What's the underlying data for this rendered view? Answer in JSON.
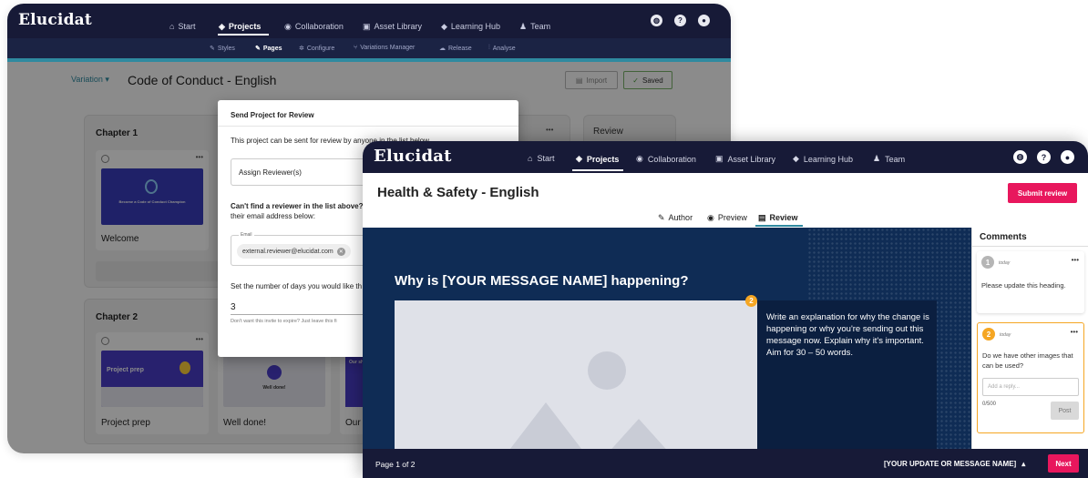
{
  "back": {
    "logo": "Elucidat",
    "nav": [
      {
        "icon": "⌂",
        "label": "Start"
      },
      {
        "icon": "◈",
        "label": "Projects"
      },
      {
        "icon": "◉",
        "label": "Collaboration"
      },
      {
        "icon": "▣",
        "label": "Asset Library"
      },
      {
        "icon": "◆",
        "label": "Learning Hub"
      },
      {
        "icon": "♟",
        "label": "Team"
      }
    ],
    "subnav": [
      {
        "icon": "✎",
        "label": "Styles"
      },
      {
        "icon": "✎",
        "label": "Pages"
      },
      {
        "icon": "✲",
        "label": "Configure"
      },
      {
        "icon": "⑂",
        "label": "Variations Manager"
      },
      {
        "icon": "☁",
        "label": "Release"
      },
      {
        "icon": "⫶",
        "label": "Analyse"
      }
    ],
    "variation_label": "Variation",
    "project_title": "Code of Conduct - English",
    "import_label": "Import",
    "saved_label": "Saved",
    "chapter1": "Chapter 1",
    "chapter2": "Chapter 2",
    "review_label": "Review",
    "page_welcome": "Welcome",
    "page_project_prep": "Project prep",
    "page_well_done": "Well done!",
    "page_our": "Our sh",
    "thumb1_text": "Become a Code of Conduct Champion",
    "thumb2_title": "Project prep",
    "thumb3_text": "Well done!",
    "thumb4_text": "Our sh",
    "more": "•••",
    "modal": {
      "title": "Send Project for Review",
      "intro": "This project can be sent for review by anyone in the list below.",
      "assign": "Assign Reviewer(s)",
      "cant_find": "Can't find a reviewer in the list above? A",
      "cant_find_2": "their email address below:",
      "email_label": "Email",
      "email_chip": "external.reviewer@elucidat.com",
      "days_label": "Set the number of days you would like th",
      "days_value": "3",
      "days_hint": "Don't want this invite to expire? Just leave this fi"
    }
  },
  "front": {
    "logo": "Elucidat",
    "nav": [
      {
        "icon": "⌂",
        "label": "Start"
      },
      {
        "icon": "◈",
        "label": "Projects"
      },
      {
        "icon": "◉",
        "label": "Collaboration"
      },
      {
        "icon": "▣",
        "label": "Asset Library"
      },
      {
        "icon": "◆",
        "label": "Learning Hub"
      },
      {
        "icon": "♟",
        "label": "Team"
      }
    ],
    "project_title": "Health & Safety - English",
    "submit_review": "Submit review",
    "tabs": [
      {
        "icon": "✎",
        "label": "Author"
      },
      {
        "icon": "◉",
        "label": "Preview"
      },
      {
        "icon": "▤",
        "label": "Review"
      }
    ],
    "slide_heading": "Why is [YOUR MESSAGE NAME] happening?",
    "slide_body": "Write an explanation for why the change is happening or why you're sending out this message now. Explain why it's important. Aim for 30 – 50 words.",
    "marker_num": "2",
    "comments_title": "Comments",
    "comment1": {
      "num": "1",
      "time": "today",
      "text": "Please update this heading."
    },
    "comment2": {
      "num": "2",
      "time": "today",
      "text": "Do we have other images that can be used?",
      "reply_placeholder": "Add a reply...",
      "count": "0/500",
      "post": "Post"
    },
    "page_indicator": "Page 1 of 2",
    "update_menu": "[YOUR UPDATE OR MESSAGE NAME]",
    "next": "Next",
    "more": "•••"
  },
  "colors": {
    "nav_bg": "#171a37",
    "accent_pink": "#e8175d",
    "slide_bg": "#0f2c55",
    "marker_orange": "#f5a623",
    "teal": "#2f8aa0"
  }
}
